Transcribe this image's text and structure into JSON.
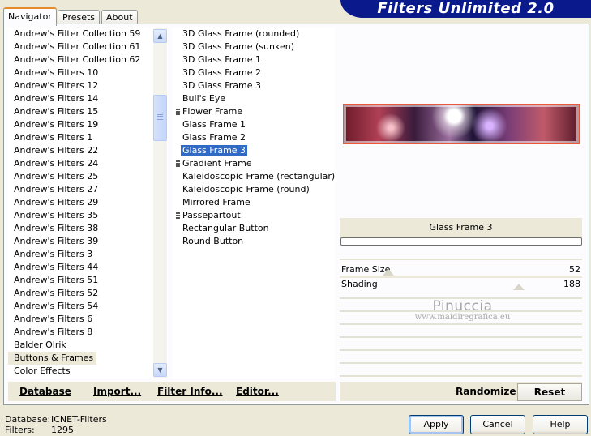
{
  "tabs": [
    "Navigator",
    "Presets",
    "About"
  ],
  "banner_title": "Filters Unlimited 2.0",
  "categories": [
    "Andrew's Filter Collection 59",
    "Andrew's Filter Collection 61",
    "Andrew's Filter Collection 62",
    "Andrew's Filters 10",
    "Andrew's Filters 12",
    "Andrew's Filters 14",
    "Andrew's Filters 15",
    "Andrew's Filters 19",
    "Andrew's Filters 1",
    "Andrew's Filters 22",
    "Andrew's Filters 24",
    "Andrew's Filters 25",
    "Andrew's Filters 27",
    "Andrew's Filters 29",
    "Andrew's Filters 35",
    "Andrew's Filters 38",
    "Andrew's Filters 39",
    "Andrew's Filters 3",
    "Andrew's Filters 44",
    "Andrew's Filters 51",
    "Andrew's Filters 52",
    "Andrew's Filters 54",
    "Andrew's Filters 6",
    "Andrew's Filters 8",
    "Balder Olrik",
    "Buttons & Frames",
    "Color Effects"
  ],
  "selected_category": "Buttons & Frames",
  "filters": [
    {
      "name": "3D Glass Frame (rounded)",
      "marker": false
    },
    {
      "name": "3D Glass Frame (sunken)",
      "marker": false
    },
    {
      "name": "3D Glass Frame 1",
      "marker": false
    },
    {
      "name": "3D Glass Frame 2",
      "marker": false
    },
    {
      "name": "3D Glass Frame 3",
      "marker": false
    },
    {
      "name": "Bull's Eye",
      "marker": false
    },
    {
      "name": "Flower Frame",
      "marker": true
    },
    {
      "name": "Glass Frame 1",
      "marker": false
    },
    {
      "name": "Glass Frame 2",
      "marker": false
    },
    {
      "name": "Glass Frame 3",
      "marker": false
    },
    {
      "name": "Gradient Frame",
      "marker": true
    },
    {
      "name": "Kaleidoscopic Frame (rectangular)",
      "marker": false
    },
    {
      "name": "Kaleidoscopic Frame (round)",
      "marker": false
    },
    {
      "name": "Mirrored Frame",
      "marker": false
    },
    {
      "name": "Passepartout",
      "marker": true
    },
    {
      "name": "Rectangular Button",
      "marker": false
    },
    {
      "name": "Round Button",
      "marker": false
    }
  ],
  "selected_filter": "Glass Frame 3",
  "preview": {
    "filter_name": "Glass Frame 3",
    "progress_fraction": 0
  },
  "params": [
    {
      "label": "Frame Size",
      "value": "52",
      "level": 0.2
    },
    {
      "label": "Shading",
      "value": "188",
      "level": 0.74
    }
  ],
  "watermark": {
    "line1": "Pinuccia",
    "line2": "www.maidiregrafica.eu"
  },
  "buttons": {
    "database": "Database",
    "import": "Import...",
    "filter_info": "Filter Info...",
    "editor": "Editor...",
    "randomize": "Randomize",
    "reset": "Reset",
    "apply": "Apply",
    "cancel": "Cancel",
    "help": "Help"
  },
  "status": {
    "database_label": "Database:",
    "database_value": "ICNET-Filters",
    "filters_label": "Filters:",
    "filters_value": "1295"
  },
  "colors": {
    "selection_blue": "#316ac5",
    "banner_blue": "#0a1a8c",
    "tab_accent": "#e68b2c"
  }
}
